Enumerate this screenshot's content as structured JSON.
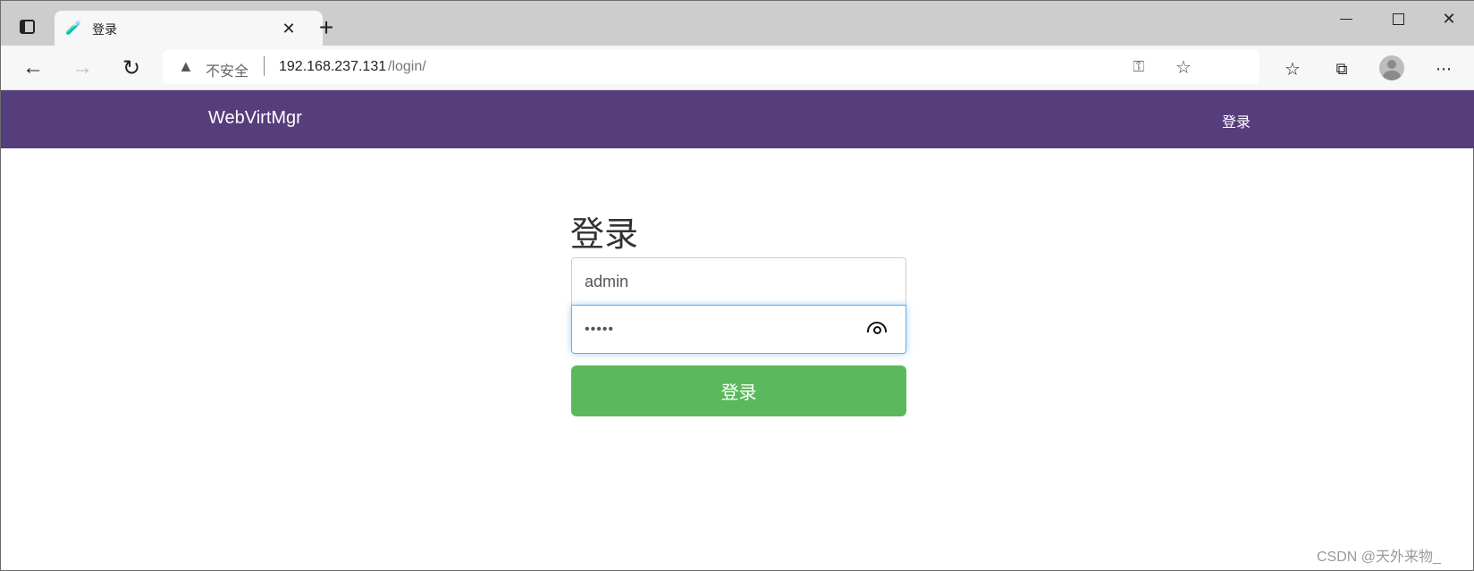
{
  "browser": {
    "tab_title": "登录",
    "security_label": "不安全",
    "url_host": "192.168.237.131",
    "url_path": "/login/"
  },
  "navbar": {
    "brand": "WebVirtMgr",
    "login_link": "登录"
  },
  "form": {
    "heading": "登录",
    "username_value": "admin",
    "password_value": "•••••",
    "submit_label": "登录"
  },
  "watermark": "CSDN @天外来物_",
  "colors": {
    "navbar": "#563d7c",
    "button": "#5cb85c"
  }
}
